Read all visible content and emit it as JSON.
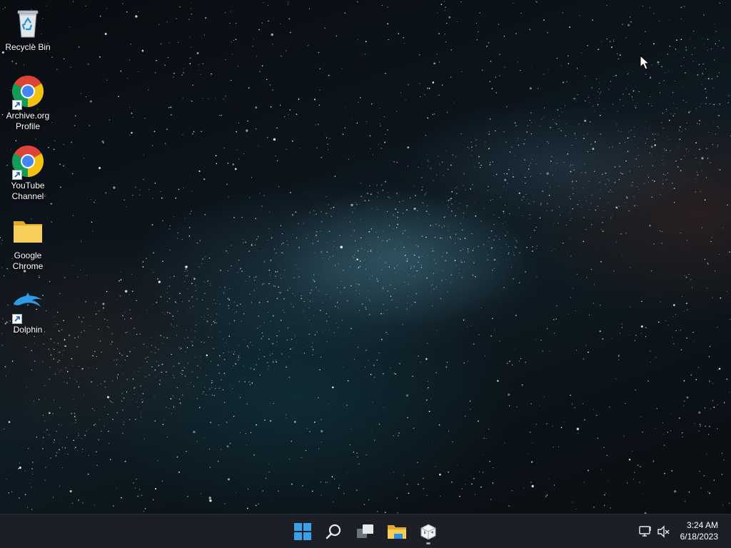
{
  "desktop": {
    "icons": [
      {
        "label": "Recycle Bin",
        "icon": "recycle-bin-icon",
        "shortcut": false
      },
      {
        "label": "Archive.org\nProfile",
        "icon": "chrome-icon",
        "shortcut": true
      },
      {
        "label": "YouTube\nChannel",
        "icon": "chrome-icon",
        "shortcut": true
      },
      {
        "label": "Google\nChrome",
        "icon": "folder-icon",
        "shortcut": false
      },
      {
        "label": "Dolphin",
        "icon": "dolphin-icon",
        "shortcut": true
      }
    ]
  },
  "taskbar": {
    "buttons": [
      {
        "name": "start",
        "icon": "windows-logo-icon"
      },
      {
        "name": "search",
        "icon": "search-icon"
      },
      {
        "name": "task-view",
        "icon": "task-view-icon"
      },
      {
        "name": "file-explorer",
        "icon": "folder-icon"
      },
      {
        "name": "virtualbox-app",
        "icon": "box-app-icon",
        "running": true
      }
    ],
    "tray": {
      "network_icon": "network-monitor-icon",
      "volume_icon": "volume-muted-icon"
    },
    "clock": {
      "time": "3:24 AM",
      "date": "6/18/2023"
    }
  },
  "colors": {
    "taskbar_bg": "#1c2026",
    "accent": "#3aa0e8",
    "folder": "#f3c64b"
  }
}
